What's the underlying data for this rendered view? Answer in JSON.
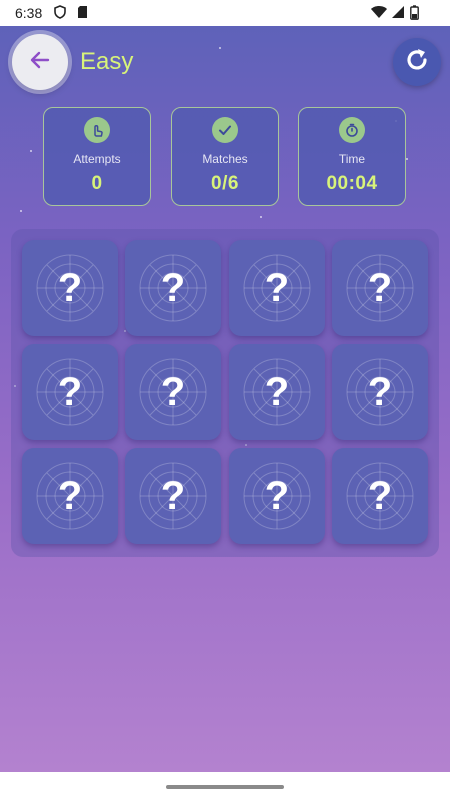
{
  "status_bar": {
    "time": "6:38"
  },
  "header": {
    "title": "Easy"
  },
  "stats": [
    {
      "label": "Attempts",
      "value": "0",
      "icon": "tap-icon"
    },
    {
      "label": "Matches",
      "value": "0/6",
      "icon": "check-icon"
    },
    {
      "label": "Time",
      "value": "00:04",
      "icon": "stopwatch-icon"
    }
  ],
  "cards": [
    {
      "face": "?"
    },
    {
      "face": "?"
    },
    {
      "face": "?"
    },
    {
      "face": "?"
    },
    {
      "face": "?"
    },
    {
      "face": "?"
    },
    {
      "face": "?"
    },
    {
      "face": "?"
    },
    {
      "face": "?"
    },
    {
      "face": "?"
    },
    {
      "face": "?"
    },
    {
      "face": "?"
    }
  ],
  "colors": {
    "accent": "#d8f37a",
    "card": "#5c62b4",
    "stat_border": "#a8c69a",
    "icon_badge": "#9bc88c",
    "back_arrow": "#8e4ec8"
  }
}
